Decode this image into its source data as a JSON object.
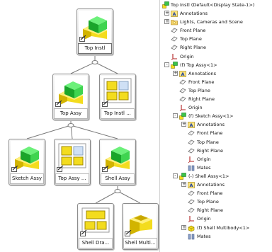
{
  "diagram": {
    "nodes": [
      {
        "id": "top-instl",
        "label": "Top Instl"
      },
      {
        "id": "top-assy",
        "label": "Top Assy"
      },
      {
        "id": "top-instl-drw",
        "label": "Top Instl ..."
      },
      {
        "id": "sketch-assy",
        "label": "Sketch Assy"
      },
      {
        "id": "top-assy-drw",
        "label": "Top Assy ..."
      },
      {
        "id": "shell-assy",
        "label": "Shell Assy"
      },
      {
        "id": "shell-drawing",
        "label": "Shell Dra..."
      },
      {
        "id": "shell-multibody",
        "label": "Shell Multi..."
      }
    ]
  },
  "tree": {
    "root_label": "Top Instl (Default<Display State-1>)",
    "rows": [
      {
        "label": "Annotations",
        "icon": "annotations-icon"
      },
      {
        "label": "Lights, Cameras and Scene",
        "icon": "lights-folder-icon"
      },
      {
        "label": "Front Plane",
        "icon": "plane-icon"
      },
      {
        "label": "Top Plane",
        "icon": "plane-icon"
      },
      {
        "label": "Right Plane",
        "icon": "plane-icon"
      },
      {
        "label": "Origin",
        "icon": "origin-icon"
      },
      {
        "label": "(f) Top Assy<1>",
        "icon": "assembly-icon"
      },
      {
        "label": "Annotations",
        "icon": "annotations-icon"
      },
      {
        "label": "Front Plane",
        "icon": "plane-icon"
      },
      {
        "label": "Top Plane",
        "icon": "plane-icon"
      },
      {
        "label": "Right Plane",
        "icon": "plane-icon"
      },
      {
        "label": "Origin",
        "icon": "origin-icon"
      },
      {
        "label": "(f) Sketch Assy<1>",
        "icon": "assembly-icon"
      },
      {
        "label": "Annotations",
        "icon": "annotations-icon"
      },
      {
        "label": "Front Plane",
        "icon": "plane-icon"
      },
      {
        "label": "Top Plane",
        "icon": "plane-icon"
      },
      {
        "label": "Right Plane",
        "icon": "plane-icon"
      },
      {
        "label": "Origin",
        "icon": "origin-icon"
      },
      {
        "label": "Mates",
        "icon": "mates-icon"
      },
      {
        "label": "(-) Shell Assy<1>",
        "icon": "assembly-icon"
      },
      {
        "label": "Annotations",
        "icon": "annotations-icon"
      },
      {
        "label": "Front Plane",
        "icon": "plane-icon"
      },
      {
        "label": "Top Plane",
        "icon": "plane-icon"
      },
      {
        "label": "Right Plane",
        "icon": "plane-icon"
      },
      {
        "label": "Origin",
        "icon": "origin-icon"
      },
      {
        "label": "(f) Shell Multibody<1>",
        "icon": "part-icon"
      },
      {
        "label": "Mates",
        "icon": "mates-icon"
      }
    ]
  }
}
